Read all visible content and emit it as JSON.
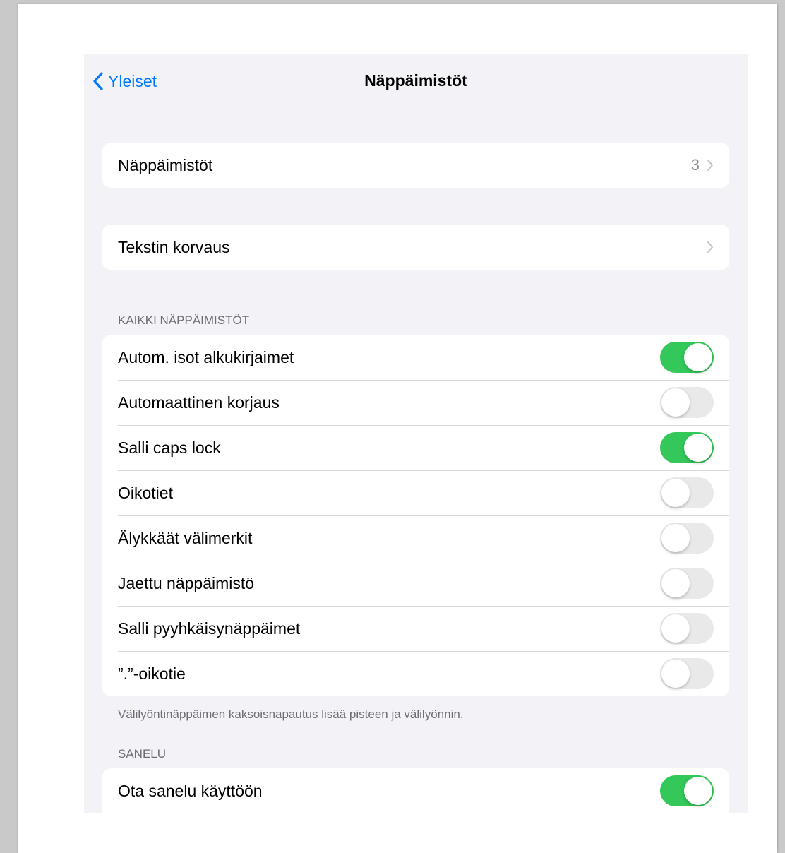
{
  "nav": {
    "back_label": "Yleiset",
    "title": "Näppäimistöt"
  },
  "keyboards_row": {
    "label": "Näppäimistöt",
    "value": "3"
  },
  "text_replacement_row": {
    "label": "Tekstin korvaus"
  },
  "all_keyboards": {
    "header": "KAIKKI NÄPPÄIMISTÖT",
    "items": [
      {
        "label": "Autom. isot alkukirjaimet",
        "on": true
      },
      {
        "label": "Automaattinen korjaus",
        "on": false
      },
      {
        "label": "Salli caps lock",
        "on": true
      },
      {
        "label": "Oikotiet",
        "on": false
      },
      {
        "label": "Älykkäät välimerkit",
        "on": false
      },
      {
        "label": "Jaettu näppäimistö",
        "on": false
      },
      {
        "label": "Salli pyyhkäisynäppäimet",
        "on": false
      },
      {
        "label": "”.”-oikotie",
        "on": false
      }
    ],
    "footer": "Välilyöntinäppäimen kaksoisnapautus lisää pisteen ja välilyönnin."
  },
  "dictation": {
    "header": "SANELU",
    "items": [
      {
        "label": "Ota sanelu käyttöön",
        "on": true
      }
    ]
  },
  "colors": {
    "accent": "#007aff",
    "toggle_on": "#34c759",
    "toggle_off": "#e9e9ea",
    "background": "#f2f2f7"
  },
  "icons": {
    "back": "chevron-left-icon",
    "disclosure": "chevron-right-icon"
  }
}
